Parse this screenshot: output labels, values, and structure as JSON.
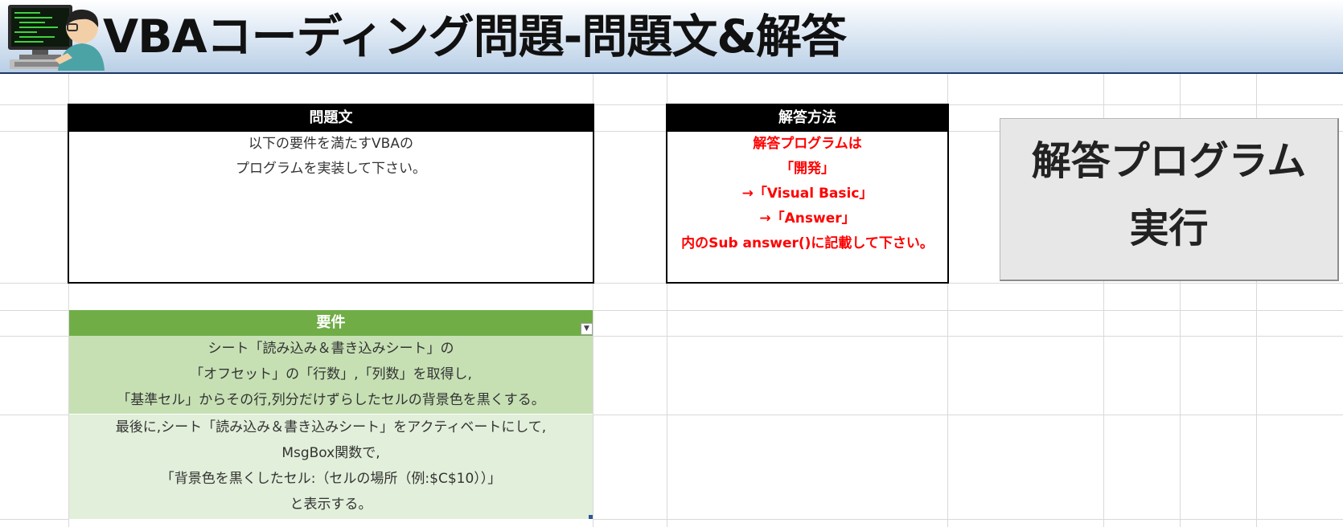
{
  "banner": {
    "title": "VBAコーディング問題-問題文&解答",
    "icon": "programmer-at-computer-icon"
  },
  "problem": {
    "header": "問題文",
    "lines": [
      "以下の要件を満たすVBAの",
      "プログラムを実装して下さい。"
    ]
  },
  "answer_method": {
    "header": "解答方法",
    "lines": [
      "解答プログラムは",
      "「開発」",
      "→「Visual Basic」",
      "→「Answer」",
      "内のSub answer()に記載して下さい。"
    ],
    "color": "#ff0000"
  },
  "run_button": {
    "line1": "解答プログラム",
    "line2": "実行"
  },
  "requirements": {
    "header": "要件",
    "filter_icon": "dropdown-filter-icon",
    "header_color": "#70ad47",
    "rows": [
      {
        "lines": [
          "シート「読み込み＆書き込みシート」の",
          "「オフセット」の「行数」,「列数」を取得し,",
          "「基準セル」からその行,列分だけずらしたセルの背景色を黒くする。"
        ]
      },
      {
        "lines": [
          "最後に,シート「読み込み＆書き込みシート」をアクティベートにして,",
          "MsgBox関数で,",
          "「背景色を黒くしたセル:（セルの場所（例:$C$10））」",
          "と表示する。"
        ]
      }
    ]
  }
}
